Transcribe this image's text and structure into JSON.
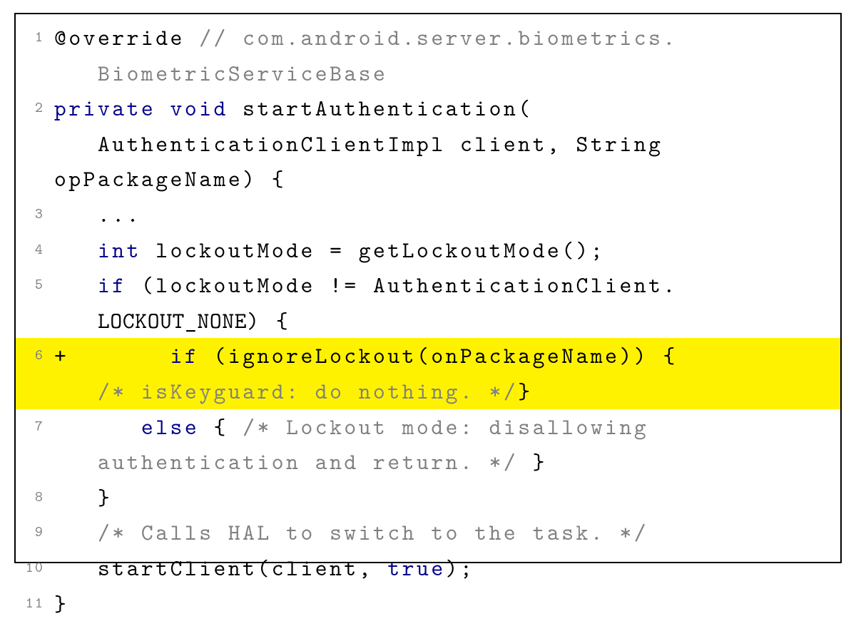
{
  "colors": {
    "highlight": "#fff200",
    "keyword": "#00008b",
    "comment": "#808080",
    "text": "#000000"
  },
  "line_numbers": [
    "1",
    "2",
    "3",
    "4",
    "5",
    "6",
    "7",
    "8",
    "9",
    "10",
    "11"
  ],
  "tokens": {
    "l1_override": "@override",
    "l1_comment_a": " // com.android.server.biometrics.",
    "l1_comment_b": "BiometricServiceBase",
    "l2_private": "private",
    "l2_void": " void",
    "l2_rest_a": " startAuthentication(",
    "l2_rest_b": "AuthenticationClientImpl client, String opPackageName) {",
    "l3": "...",
    "l4_int": "int",
    "l4_rest": " lockoutMode = getLockoutMode();",
    "l5_if": "if",
    "l5_rest_a": " (lockoutMode != AuthenticationClient.",
    "l5_rest_b": "LOCKOUT_NONE",
    "l5_rest_c": ") {",
    "l6_plus": "+       ",
    "l6_if": "if",
    "l6_rest": " (ignoreLockout(onPackageName)) {",
    "l6_comment": "/* isKeyguard: do nothing. */",
    "l6_close": "}",
    "l7_else": "else",
    "l7_brace": " { ",
    "l7_comment_a": "/* Lockout mode: disallowing ",
    "l7_comment_b": "authentication and return. */",
    "l7_close": " }",
    "l8": "}",
    "l9_comment": "/* Calls HAL to switch to the task. */",
    "l10_a": "startClient(client, ",
    "l10_true": "true",
    "l10_b": ");",
    "l11": "}"
  }
}
